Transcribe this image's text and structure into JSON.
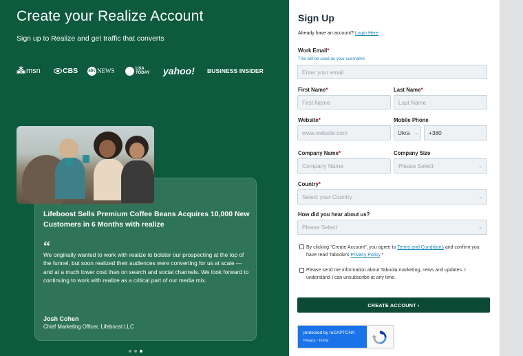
{
  "hero": {
    "title": "Create your Realize Account",
    "subtitle": "Sign up to Realize and get traffic that converts"
  },
  "logos": {
    "msn": "msn",
    "cbs": "CBS",
    "abc": "NEWS",
    "abc_circle": "abc",
    "usa_1": "USA",
    "usa_2": "TODAY",
    "yahoo": "yahoo!",
    "bi": "BUSINESS INSIDER"
  },
  "case_study": {
    "title": "Lifeboost Sells Premium Coffee Beans Acquires 10,000 New Customers in 6 Months with realize",
    "quote_mark": "“",
    "quote": "We originally wanted to work with realize to bolster our prospecting at the top of the funnel, but soon realized their audiences were converting for us at scale — and at a much lower cost than on search and social channels. We look forward to continuing to work with realize as a critical part of our media mix.",
    "author": "Josh Cohen",
    "role": "Chief Marketing Officer, Lifeboost LLC",
    "carousel_dots": 3,
    "active_dot": 3
  },
  "form": {
    "title": "Sign Up",
    "already_text": "Already have an account?",
    "login_link": "Login Here",
    "work_email": {
      "label": "Work Email",
      "hint": "This will be used as your username",
      "placeholder": "Enter your email"
    },
    "first_name": {
      "label": "First Name",
      "placeholder": "First Name"
    },
    "last_name": {
      "label": "Last Name",
      "placeholder": "Last Name"
    },
    "website": {
      "label": "Website",
      "placeholder": "www.website.com"
    },
    "mobile_phone": {
      "label": "Mobile Phone",
      "country": "Ukra",
      "code": "+380"
    },
    "company_name": {
      "label": "Company Name",
      "placeholder": "Company Name"
    },
    "company_size": {
      "label": "Company Size",
      "placeholder": "Please Select"
    },
    "country": {
      "label": "Country",
      "placeholder": "Select your Country"
    },
    "heard": {
      "label": "How did you hear about us?",
      "placeholder": "Please Select"
    },
    "required_mark": "*",
    "terms": {
      "pre": "By clicking “Create Account”, you agree to",
      "link1": "Terms and Conditions",
      "mid": "and confirm you have read Taboola’s",
      "link2": "Privacy Policy",
      "post": "."
    },
    "marketing": "Please send me information about Taboola marketing, news and updates. I understand I can unsubscribe at any time.",
    "submit": "CREATE ACCOUNT ›",
    "recaptcha": {
      "line1": "protected by reCAPTCHA",
      "line2": "Privacy - Terms"
    }
  },
  "colors": {
    "brand_green": "#0d5a3e",
    "button_green": "#0d4a36",
    "link_blue": "#1a85b8",
    "required_red": "#d0021b"
  }
}
